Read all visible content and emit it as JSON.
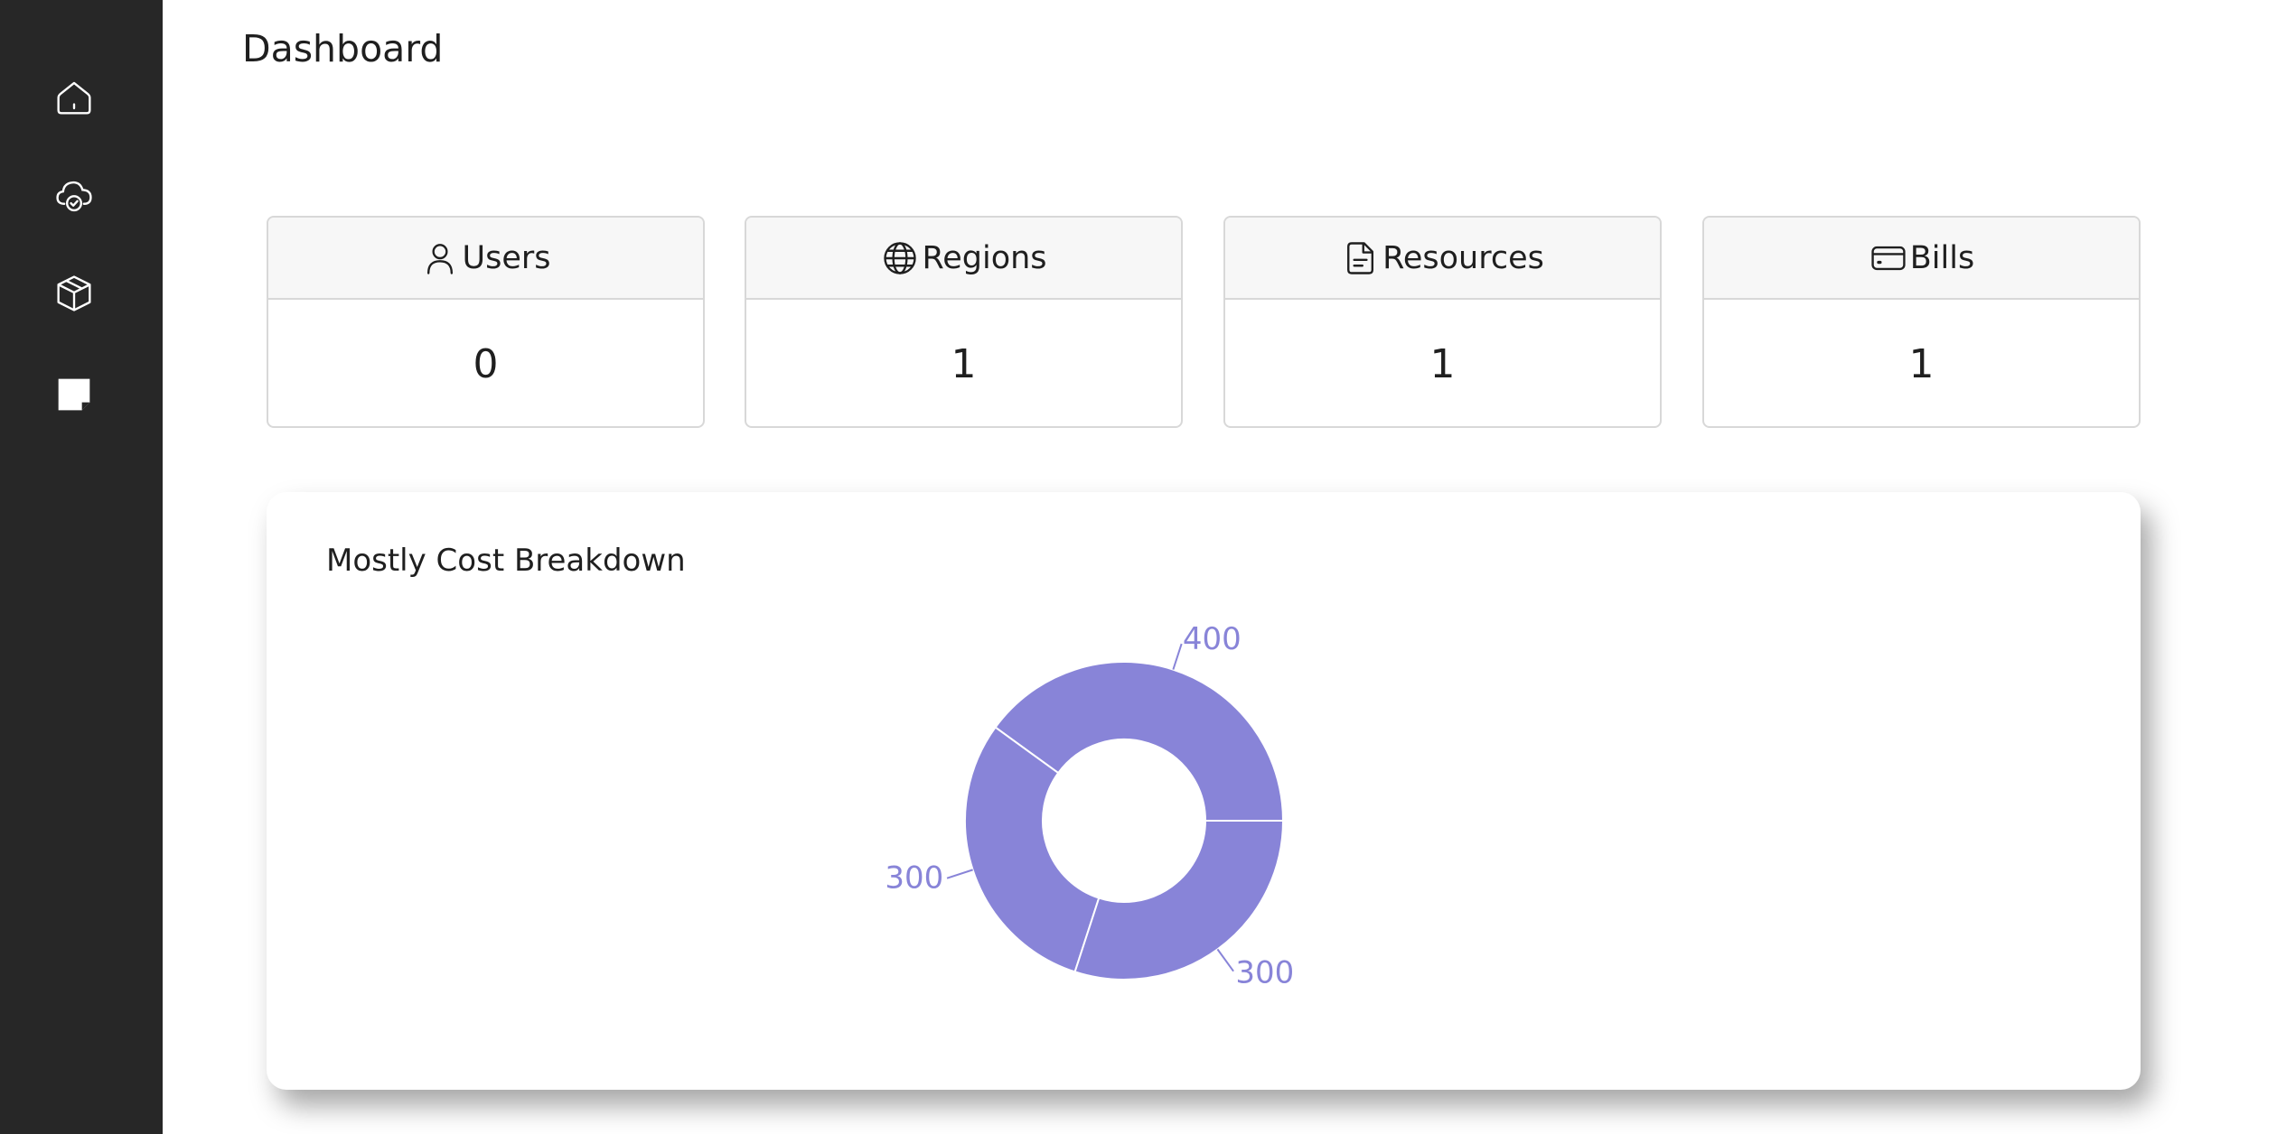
{
  "sidebar": {
    "items": [
      {
        "name": "home",
        "icon": "home-icon"
      },
      {
        "name": "cloud",
        "icon": "cloud-check-icon"
      },
      {
        "name": "resources",
        "icon": "cube-icon"
      },
      {
        "name": "notes",
        "icon": "sticky-note-icon"
      }
    ],
    "background": "#272727"
  },
  "header": {
    "title": "Dashboard"
  },
  "stats": [
    {
      "label": "Users",
      "value": "0",
      "icon": "user-icon"
    },
    {
      "label": "Regions",
      "value": "1",
      "icon": "globe-icon"
    },
    {
      "label": "Resources",
      "value": "1",
      "icon": "document-icon"
    },
    {
      "label": "Bills",
      "value": "1",
      "icon": "credit-card-icon"
    }
  ],
  "chart": {
    "title": "Mostly Cost Breakdown"
  },
  "chart_data": {
    "type": "pie",
    "donut": true,
    "title": "Mostly Cost Breakdown",
    "values": [
      400,
      300,
      300
    ],
    "labels": [
      "400",
      "300",
      "300"
    ],
    "color": "#8884d8",
    "label_color": "#8884d8"
  }
}
